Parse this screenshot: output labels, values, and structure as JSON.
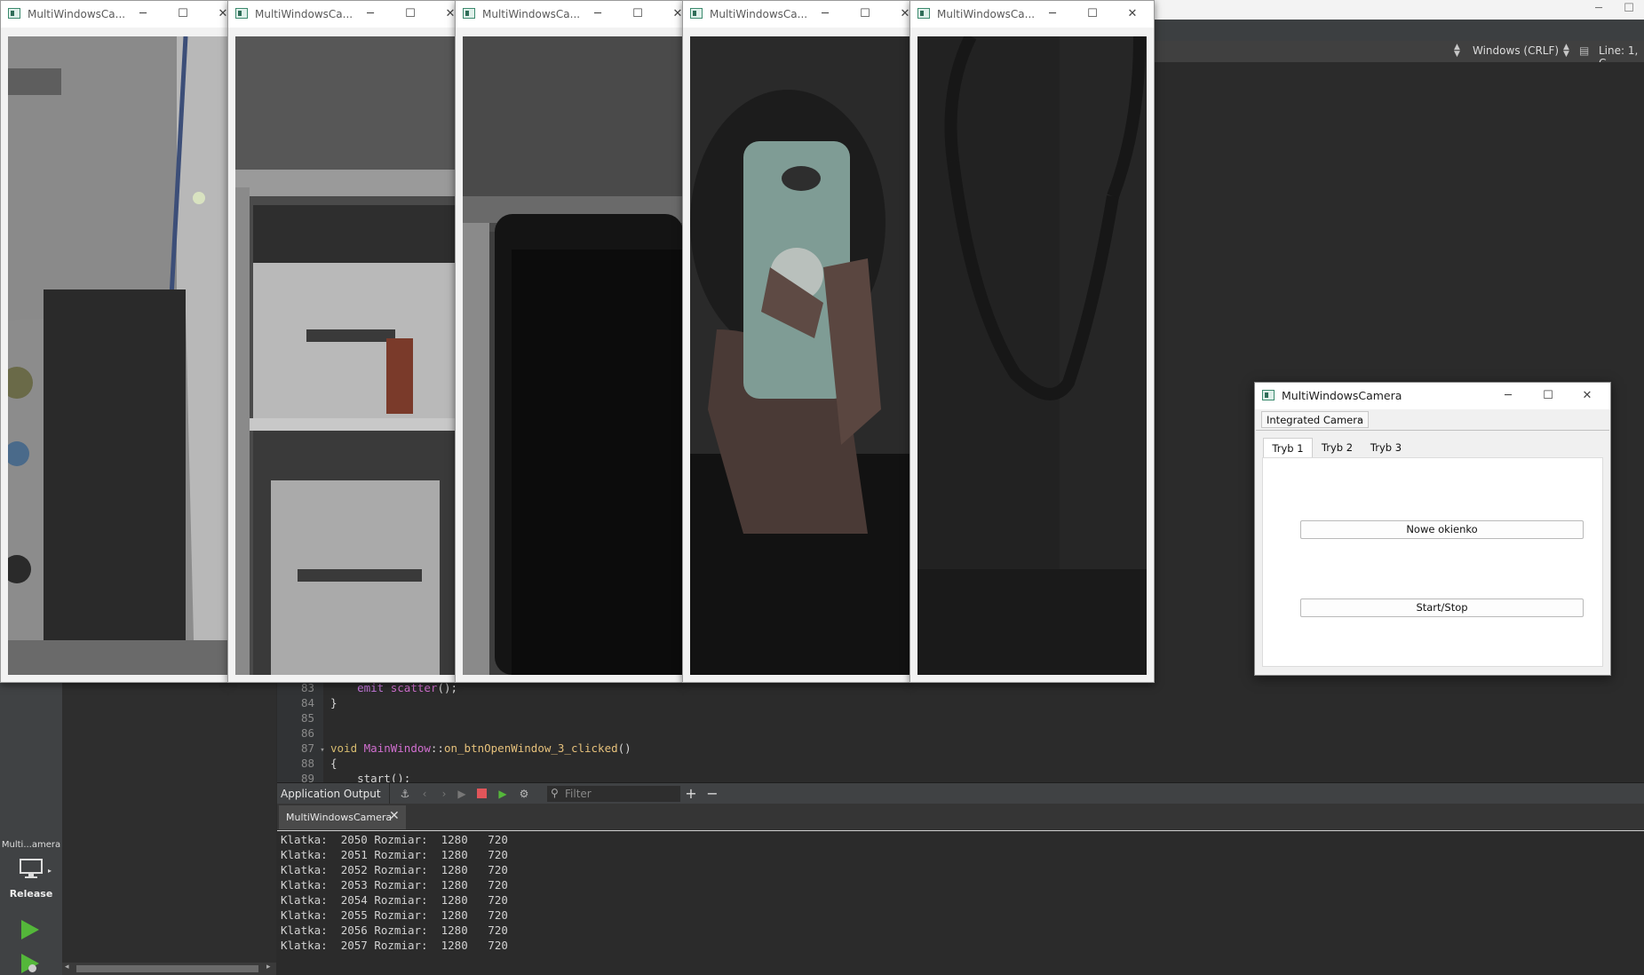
{
  "ide": {
    "encoding": "Windows (CRLF)",
    "position": "Line: 1, C",
    "kit_name": "Multi...amera",
    "build_config": "Release"
  },
  "code": [
    {
      "num": "83",
      "parts": [
        {
          "t": "    ",
          "c": ""
        },
        {
          "t": "emit",
          "c": "kw-emit"
        },
        {
          "t": " ",
          "c": ""
        },
        {
          "t": "scatter",
          "c": "fn-purple"
        },
        {
          "t": "();",
          "c": ""
        }
      ]
    },
    {
      "num": "84",
      "parts": [
        {
          "t": "}",
          "c": ""
        }
      ]
    },
    {
      "num": "85",
      "parts": []
    },
    {
      "num": "86",
      "parts": []
    },
    {
      "num": "87",
      "fold": "▾",
      "parts": [
        {
          "t": "void",
          "c": "kw-void"
        },
        {
          "t": " ",
          "c": ""
        },
        {
          "t": "MainWindow",
          "c": "type-name"
        },
        {
          "t": "::",
          "c": ""
        },
        {
          "t": "on_btnOpenWindow_3_clicked",
          "c": "method"
        },
        {
          "t": "()",
          "c": ""
        }
      ]
    },
    {
      "num": "88",
      "parts": [
        {
          "t": "{",
          "c": ""
        }
      ]
    },
    {
      "num": "89",
      "parts": [
        {
          "t": "    start();",
          "c": ""
        }
      ]
    }
  ],
  "output": {
    "title": "Application Output",
    "filter_placeholder": "Filter",
    "tab_label": "MultiWindowsCamera",
    "lines": [
      "Klatka:  2050 Rozmiar:  1280   720",
      "Klatka:  2051 Rozmiar:  1280   720",
      "Klatka:  2052 Rozmiar:  1280   720",
      "Klatka:  2053 Rozmiar:  1280   720",
      "Klatka:  2054 Rozmiar:  1280   720",
      "Klatka:  2055 Rozmiar:  1280   720",
      "Klatka:  2056 Rozmiar:  1280   720",
      "Klatka:  2057 Rozmiar:  1280   720"
    ]
  },
  "camera_windows": [
    {
      "title": "MultiWindowsCa..."
    },
    {
      "title": "MultiWindowsCa..."
    },
    {
      "title": "MultiWindowsCa..."
    },
    {
      "title": "MultiWindowsCa..."
    },
    {
      "title": "MultiWindowsCa..."
    }
  ],
  "control_window": {
    "title": "MultiWindowsCamera",
    "camera_select": "Integrated Camera",
    "tabs": [
      "Tryb 1",
      "Tryb 2",
      "Tryb 3"
    ],
    "active_tab": 0,
    "new_window_button": "Nowe okienko",
    "start_stop_button": "Start/Stop"
  },
  "colors": {
    "ide_background": "#2b2b2b",
    "run_green": "#54b73a",
    "window_chrome": "#ffffff"
  }
}
